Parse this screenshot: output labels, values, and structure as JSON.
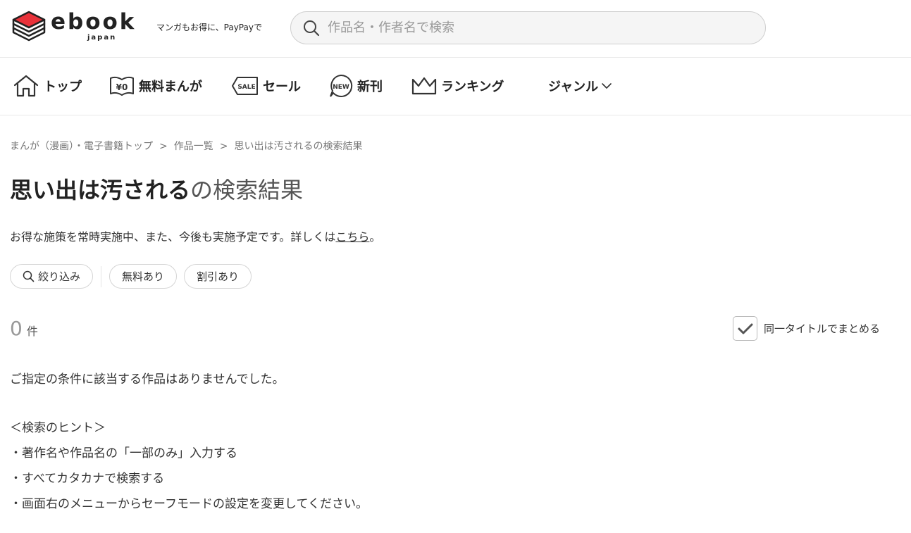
{
  "header": {
    "logo_word": "ebook",
    "logo_sub": "japan",
    "tagline": "マンガもお得に、PayPayで",
    "search_placeholder": "作品名・作者名で検索"
  },
  "nav": {
    "items": [
      {
        "label": "トップ",
        "icon": "home-icon"
      },
      {
        "label": "無料まんが",
        "icon": "free-manga-icon"
      },
      {
        "label": "セール",
        "icon": "sale-tag-icon"
      },
      {
        "label": "新刊",
        "icon": "new-badge-icon"
      },
      {
        "label": "ランキング",
        "icon": "crown-icon"
      },
      {
        "label": "ジャンル",
        "icon": "chevron-down-icon"
      }
    ]
  },
  "breadcrumb": {
    "items": [
      "まんが（漫画）・電子書籍トップ",
      "作品一覧",
      "思い出は汚されるの検索結果"
    ],
    "separator": ">"
  },
  "title": {
    "query": "思い出は汚される",
    "suffix": "の検索結果"
  },
  "notice": {
    "text": "お得な施策を常時実施中、また、今後も実施予定です。詳しくは",
    "link": "こちら",
    "tail": "。"
  },
  "filters": {
    "narrow": "絞り込み",
    "free": "無料あり",
    "discount": "割引あり"
  },
  "results": {
    "count": "0",
    "unit": "件",
    "group_label": "同一タイトルでまとめる",
    "group_checked": true
  },
  "message": {
    "no_result": "ご指定の条件に該当する作品はありませんでした。",
    "hints": [
      "＜検索のヒント＞",
      "・著作名や作品名の「一部のみ」入力する",
      "・すべてカタカナで検索する",
      "・画面右のメニューからセーフモードの設定を変更してください。"
    ]
  },
  "colors": {
    "brand_red": "#e8323a",
    "text": "#333333",
    "muted": "#999999"
  }
}
